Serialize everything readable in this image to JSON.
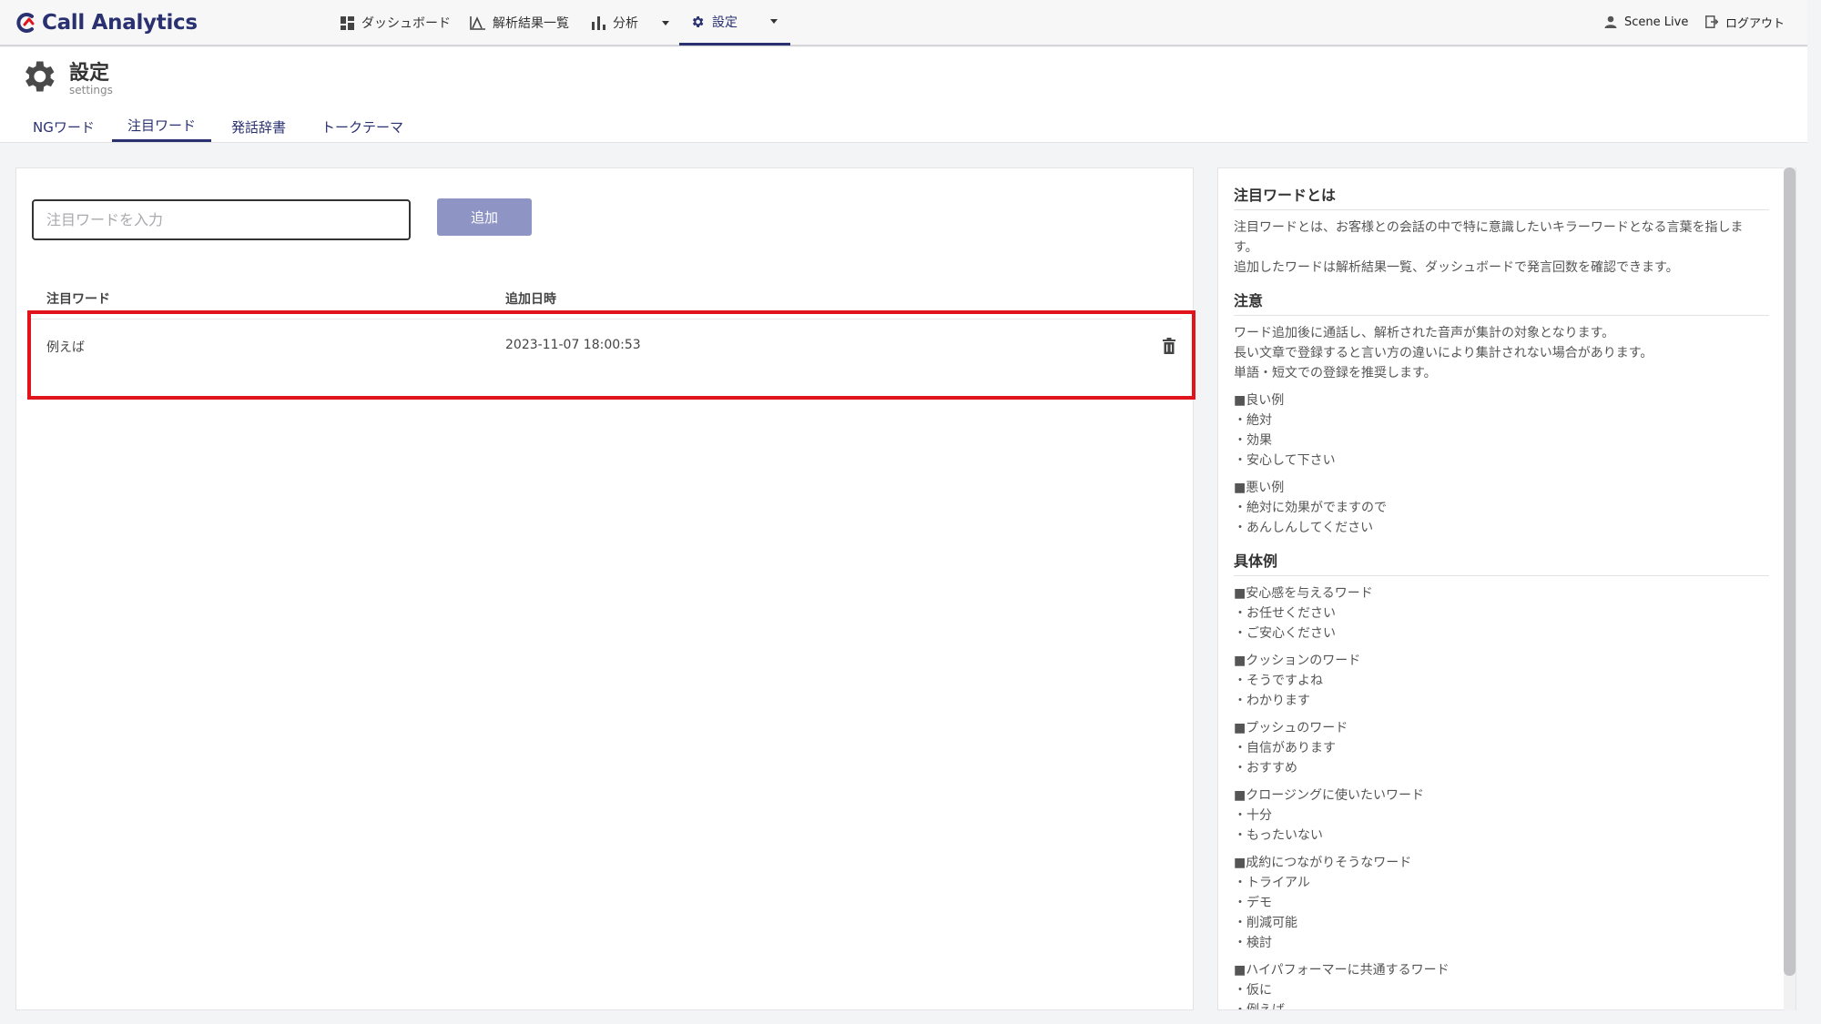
{
  "app": {
    "name": "Call Analytics"
  },
  "nav": {
    "dashboard": "ダッシュボード",
    "results": "解析結果一覧",
    "analysis": "分析",
    "settings": "設定"
  },
  "user": {
    "name": "Scene Live",
    "logout": "ログアウト"
  },
  "page": {
    "title": "設定",
    "subtitle": "settings"
  },
  "tabs": [
    {
      "label": "NGワード"
    },
    {
      "label": "注目ワード"
    },
    {
      "label": "発話辞書"
    },
    {
      "label": "トークテーマ"
    }
  ],
  "form": {
    "placeholder": "注目ワードを入力",
    "add_label": "追加"
  },
  "table": {
    "col_word": "注目ワード",
    "col_date": "追加日時",
    "rows": [
      {
        "word": "例えば",
        "date": "2023-11-07 18:00:53"
      }
    ]
  },
  "info": {
    "what_title": "注目ワードとは",
    "what_p1": "注目ワードとは、お客様との会話の中で特に意識したいキラーワードとなる言葉を指しま",
    "what_p1b": "す。",
    "what_p2": "追加したワードは解析結果一覧、ダッシュボードで発言回数を確認できます。",
    "note_title": "注意",
    "note_1": "ワード追加後に通話し、解析された音声が集計の対象となります。",
    "note_2": "長い文章で登録すると言い方の違いにより集計されない場合があります。",
    "note_3": "単語・短文での登録を推奨します。",
    "good_head": "■良い例",
    "good_1": "・絶対",
    "good_2": "・効果",
    "good_3": "・安心して下さい",
    "bad_head": "■悪い例",
    "bad_1": "・絶対に効果がでますので",
    "bad_2": "・あんしんしてください",
    "ex_title": "具体例",
    "g1_head": "■安心感を与えるワード",
    "g1_1": "・お任せください",
    "g1_2": "・ご安心ください",
    "g2_head": "■クッションのワード",
    "g2_1": "・そうですよね",
    "g2_2": "・わかります",
    "g3_head": "■プッシュのワード",
    "g3_1": "・自信があります",
    "g3_2": "・おすすめ",
    "g4_head": "■クロージングに使いたいワード",
    "g4_1": "・十分",
    "g4_2": "・もったいない",
    "g5_head": "■成約につながりそうなワード",
    "g5_1": "・トライアル",
    "g5_2": "・デモ",
    "g5_3": "・削減可能",
    "g5_4": "・検討",
    "g6_head": "■ハイパフォーマーに共通するワード",
    "g6_1": "・仮に",
    "g6_2": "・例えば"
  },
  "colors": {
    "brand": "#2a3170",
    "button": "#8e95c4",
    "highlight": "#e2141b"
  }
}
